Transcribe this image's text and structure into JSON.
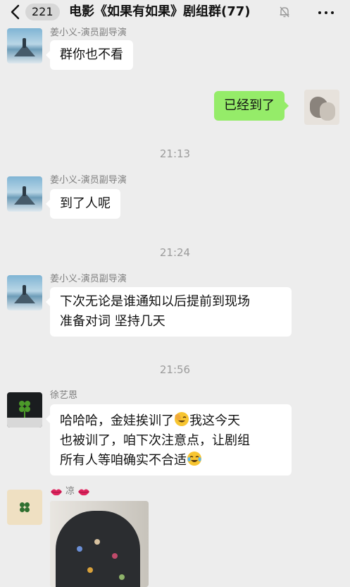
{
  "header": {
    "unread_count": "221",
    "title": "电影《如果有如果》剧组群(77)"
  },
  "icons": [
    "back-arrow-icon",
    "mute-bell-icon",
    "more-icon",
    "lips-emoji-icon",
    "facepalm-laugh-emoji-icon",
    "tears-of-joy-emoji-icon",
    "clover-avatar-icon"
  ],
  "colors": {
    "background": "#ededed",
    "self_bubble": "#95ec69",
    "other_bubble": "#ffffff"
  },
  "messages": [
    {
      "sender": "姜小义-演员副导演",
      "text": "群你也不看"
    },
    {
      "self": true,
      "text": "已经到了"
    },
    {
      "time": "21:13"
    },
    {
      "sender": "姜小义-演员副导演",
      "text": "到了人呢"
    },
    {
      "time": "21:24"
    },
    {
      "sender": "姜小义-演员副导演",
      "line1": "下次无论是谁通知以后提前到现场",
      "line2": "准备对词 坚持几天"
    },
    {
      "time": "21:56"
    },
    {
      "sender": "徐艺恩",
      "line1a": "哈哈哈，金娃挨训了",
      "line1b": "我这今天",
      "line2": "也被训了，咱下次注意点，让剧组",
      "line3": "所有人等咱确实不合适"
    },
    {
      "sender": "凉",
      "image": true
    }
  ]
}
